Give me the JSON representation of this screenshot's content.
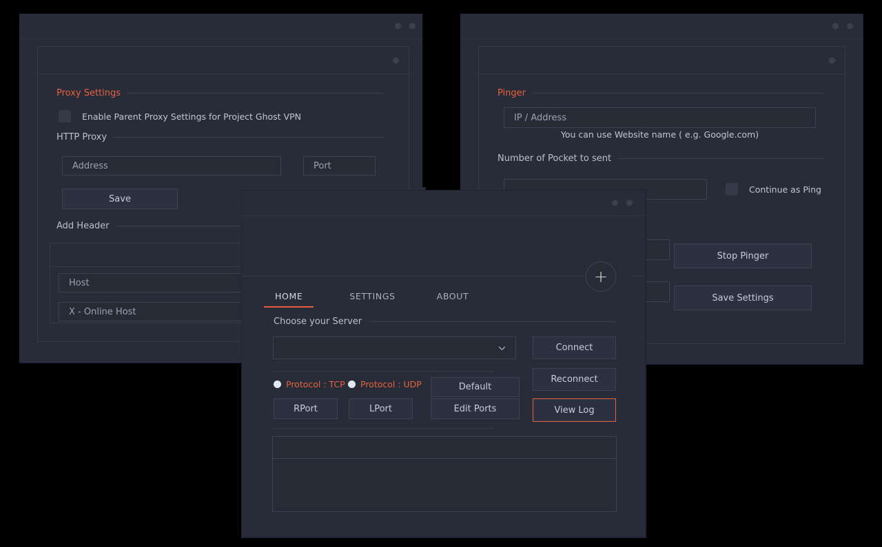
{
  "app": {
    "name": "Project Ghost VPN"
  },
  "windows": {
    "proxy": {
      "title_dots": 2,
      "sections": {
        "proxy_settings": "Proxy Settings",
        "http_proxy": "HTTP Proxy",
        "add_header": "Add Header"
      },
      "enable_parent_proxy_label": "Enable Parent Proxy Settings for Project Ghost VPN",
      "address_placeholder": "Address",
      "port_placeholder": "Port",
      "save_label": "Save",
      "header_rows": [
        {
          "value": "Host"
        },
        {
          "value": "X - Online Host"
        }
      ]
    },
    "pinger": {
      "title_dots": 2,
      "sections": {
        "pinger": "Pinger",
        "packets": "Number of Pocket to sent"
      },
      "ip_placeholder": "IP / Address",
      "hint": "You can use Website name ( e.g. Google.com)",
      "packets_value": "",
      "continue_as_ping_label": "Continue as Ping",
      "stop_pinger_label": "Stop Pinger",
      "save_settings_label": "Save Settings"
    },
    "main": {
      "title_dots": 2,
      "add_button_label": "+",
      "tabs": [
        {
          "label": "HOME",
          "active": true
        },
        {
          "label": "SETTINGS",
          "active": false
        },
        {
          "label": "ABOUT",
          "active": false
        }
      ],
      "server_section_label": "Choose your Server",
      "server_value": "",
      "connect_label": "Connect",
      "reconnect_label": "Reconnect",
      "protocol_tcp_label": "Protocol : TCP",
      "protocol_udp_label": "Protocol : UDP",
      "rport_label": "RPort",
      "lport_label": "LPort",
      "default_label": "Default",
      "edit_ports_label": "Edit Ports",
      "view_log_label": "View Log",
      "log_text": ""
    }
  },
  "colors": {
    "accent": "#e8613c",
    "window_bg": "#272c38",
    "field_bg": "#262b36",
    "border": "#3c4350",
    "text": "#c6ccd9",
    "muted": "#9aa2b1",
    "page_bg": "#000000"
  }
}
